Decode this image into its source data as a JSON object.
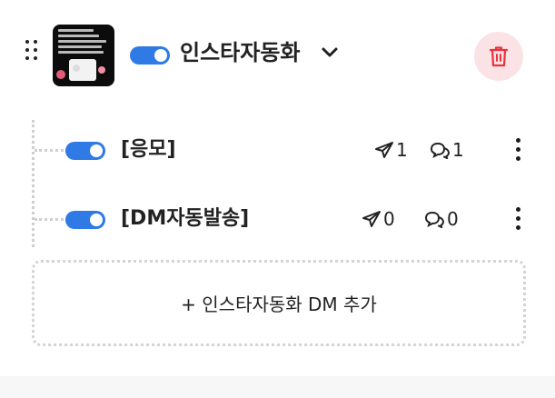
{
  "header": {
    "thumbnail_alt": "인스타자동화 thumbnail",
    "title": "인스타자동화",
    "toggle_on": true,
    "accent": "#2f7ae5",
    "trash_bg": "#fbe2e5",
    "trash_color": "#e8333f"
  },
  "items": [
    {
      "label": "[응모]",
      "sent": "1",
      "comments": "1",
      "toggle_on": true
    },
    {
      "label": "[DM자동발송]",
      "sent": "0",
      "comments": "0",
      "toggle_on": true
    }
  ],
  "add_button": {
    "label": "+ 인스타자동화 DM 추가"
  },
  "icons": {
    "drag": "drag-handle-icon",
    "chevron": "chevron-down-icon",
    "trash": "trash-icon",
    "send": "send-icon",
    "comment": "comment-icon",
    "more": "more-vertical-icon"
  }
}
